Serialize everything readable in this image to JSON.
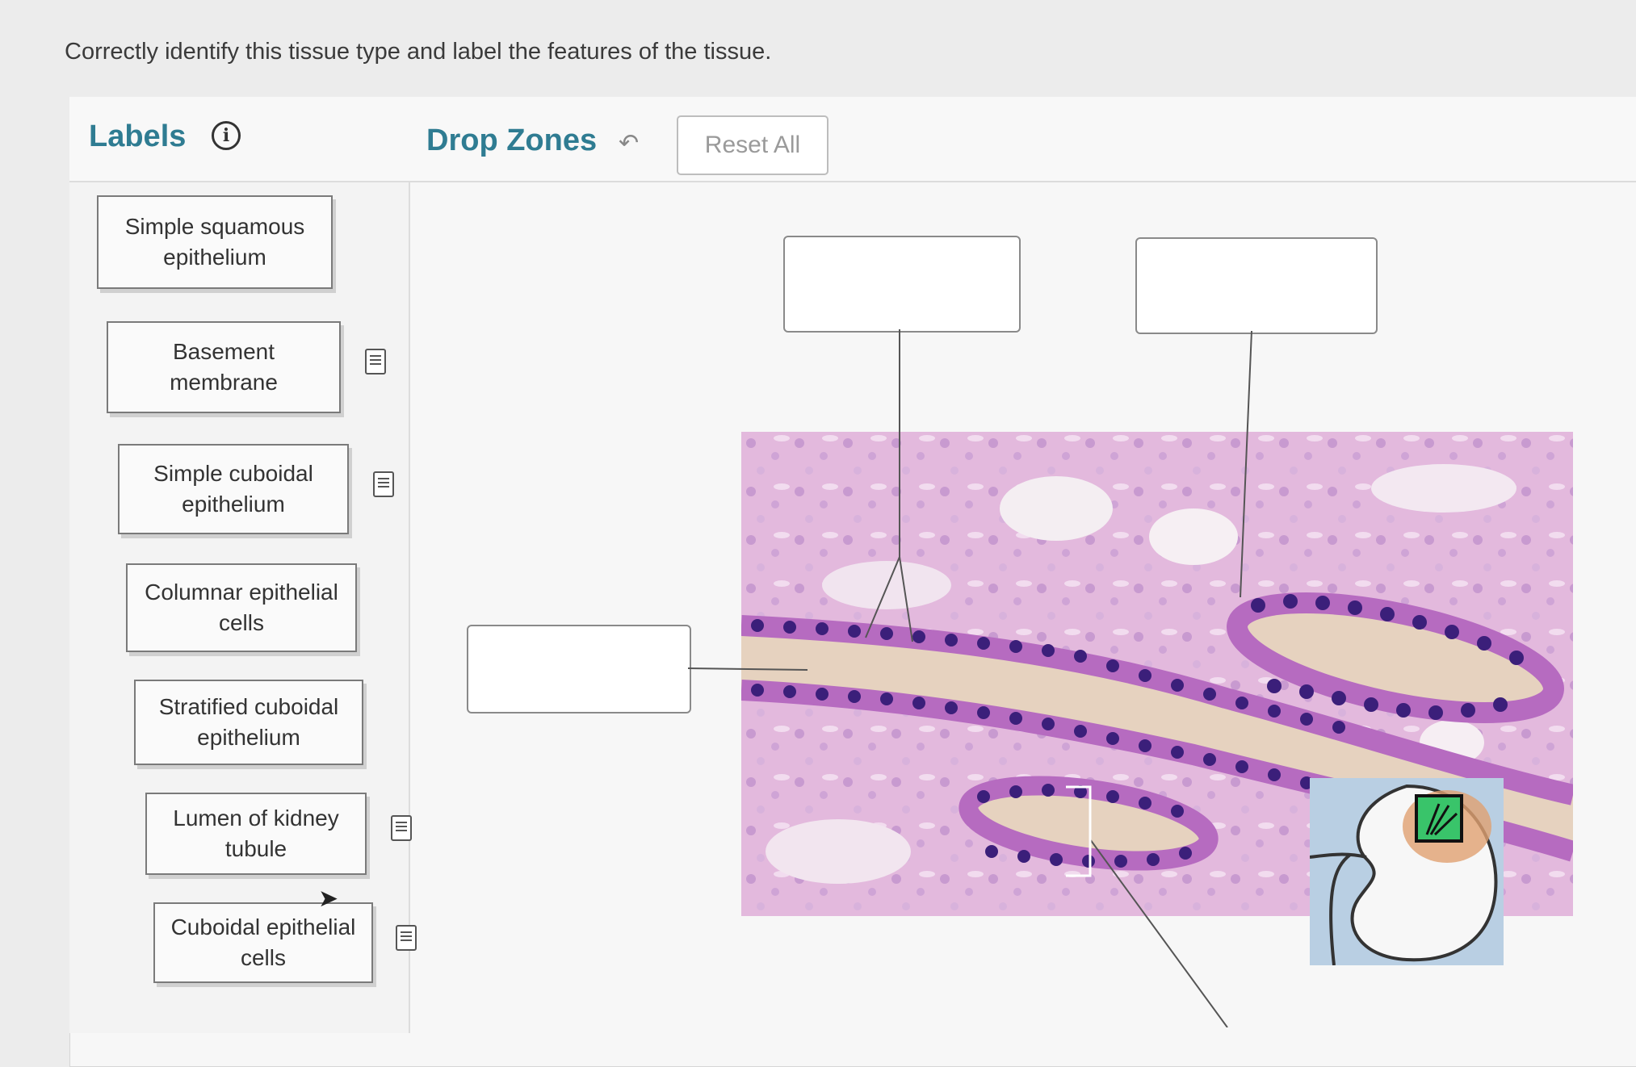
{
  "question": "Correctly identify this tissue type and label the features of the tissue.",
  "headers": {
    "labels": "Labels",
    "drop_zones": "Drop Zones",
    "reset": "Reset All"
  },
  "labels": [
    {
      "text": "Simple squamous\nepithelium",
      "has_note": false
    },
    {
      "text": "Basement\nmembrane",
      "has_note": true
    },
    {
      "text": "Simple cuboidal\nepithelium",
      "has_note": true
    },
    {
      "text": "Columnar epithelial\ncells",
      "has_note": false
    },
    {
      "text": "Stratified cuboidal\nepithelium",
      "has_note": false
    },
    {
      "text": "Lumen of kidney\ntubule",
      "has_note": true
    },
    {
      "text": "Cuboidal epithelial\ncells",
      "has_note": true
    }
  ],
  "icons": {
    "info": "info-icon",
    "undo": "undo-arrow-icon",
    "note": "note-icon",
    "cursor": "mouse-cursor-icon"
  },
  "colors": {
    "header_accent": "#2f7c92",
    "tissue_bg": "#e2b6dc",
    "nucleus": "#3b1f7a",
    "lumen": "#e6d2bf"
  }
}
